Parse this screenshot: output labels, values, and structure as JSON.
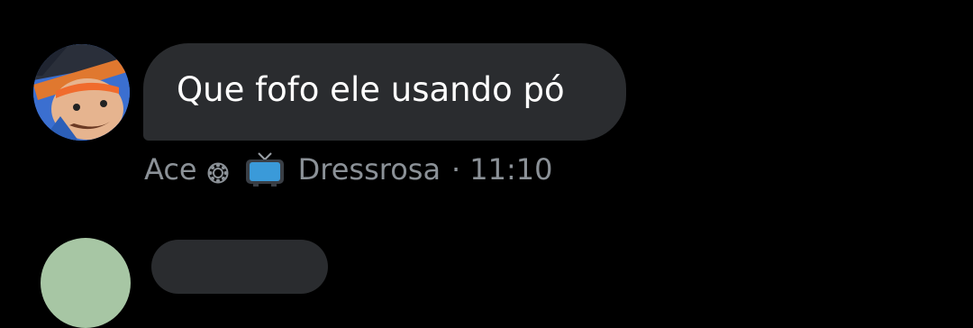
{
  "message": {
    "text": "Que fofo ele usando pó",
    "author": "Ace",
    "author_badge_icon": "sun-flower-icon",
    "location_icon": "tv-icon",
    "location": "Dressrosa",
    "separator": "·",
    "time": "11:10"
  },
  "colors": {
    "background": "#000000",
    "bubble": "#2a2c2f",
    "text": "#ffffff",
    "meta_text": "#8b9197",
    "tv_blue": "#3a9ad9"
  }
}
